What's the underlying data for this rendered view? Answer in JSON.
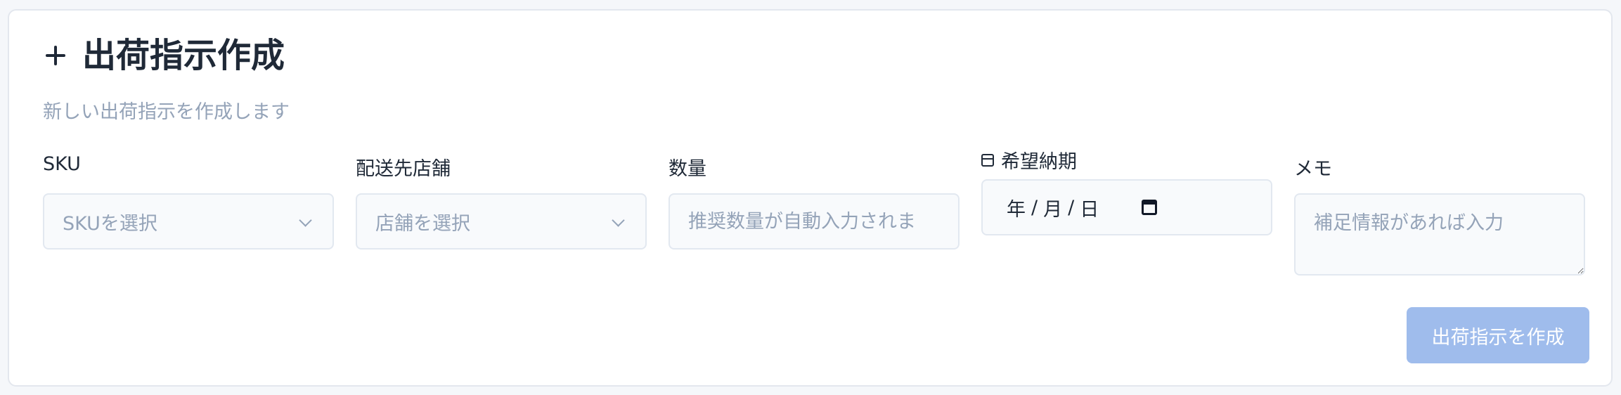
{
  "header": {
    "title": "出荷指示作成",
    "subtitle": "新しい出荷指示を作成します"
  },
  "form": {
    "sku": {
      "label": "SKU",
      "placeholder": "SKUを選択"
    },
    "store": {
      "label": "配送先店舗",
      "placeholder": "店舗を選択"
    },
    "quantity": {
      "label": "数量",
      "placeholder": "推奨数量が自動入力されま"
    },
    "due_date": {
      "label": "希望納期",
      "year": "年",
      "month": "月",
      "day": "日",
      "sep": "/"
    },
    "memo": {
      "label": "メモ",
      "placeholder": "補足情報があれば入力"
    },
    "submit_label": "出荷指示を作成"
  },
  "icons": {
    "header": "plus-icon",
    "due_date": "calendar-icon",
    "select": "chevron-down-icon"
  },
  "colors": {
    "submit_button": "#9fbcec",
    "placeholder": "#94a3b8",
    "text": "#1f2937"
  }
}
